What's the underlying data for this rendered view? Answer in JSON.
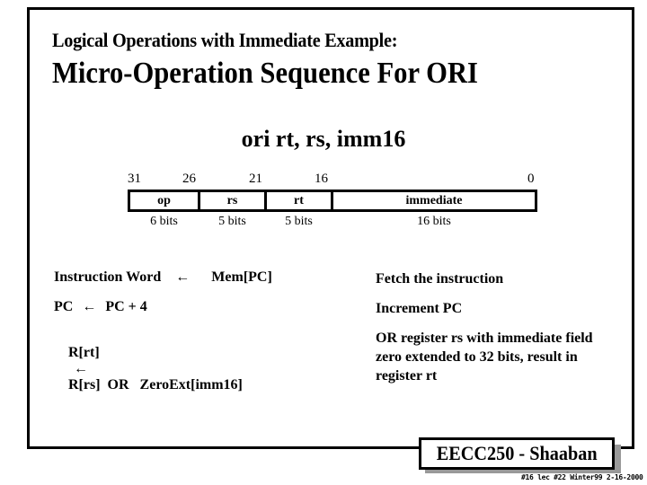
{
  "slide": {
    "subtitle": "Logical Operations with Immediate Example:",
    "title": "Micro-Operation Sequence For  ORI",
    "instruction": "ori  rt, rs, imm16"
  },
  "format": {
    "bit_numbers": [
      "31",
      "26",
      "21",
      "16",
      "0"
    ],
    "fields": [
      {
        "name": "op",
        "bits": "6 bits"
      },
      {
        "name": "rs",
        "bits": "5 bits"
      },
      {
        "name": "rt",
        "bits": "5 bits"
      },
      {
        "name": "immediate",
        "bits": "16 bits"
      }
    ]
  },
  "steps": [
    {
      "rtl_left": "Instruction Word",
      "arrow": "←",
      "rtl_right": "Mem[PC]",
      "description": "Fetch the instruction"
    },
    {
      "rtl_left": "PC",
      "arrow": "←",
      "rtl_right": "PC + 4",
      "description": "Increment PC"
    },
    {
      "rtl_left": "R[rt]",
      "arrow": "←",
      "rtl_right": "R[rs]  OR   ZeroExt[imm16]",
      "description": "OR register  rs  with immediate field zero extended to 32 bits, result in register rt"
    }
  ],
  "badge": {
    "label": "EECC250 - Shaaban"
  },
  "footer": {
    "text": "#16  lec #22  Winter99  2-16-2000"
  }
}
